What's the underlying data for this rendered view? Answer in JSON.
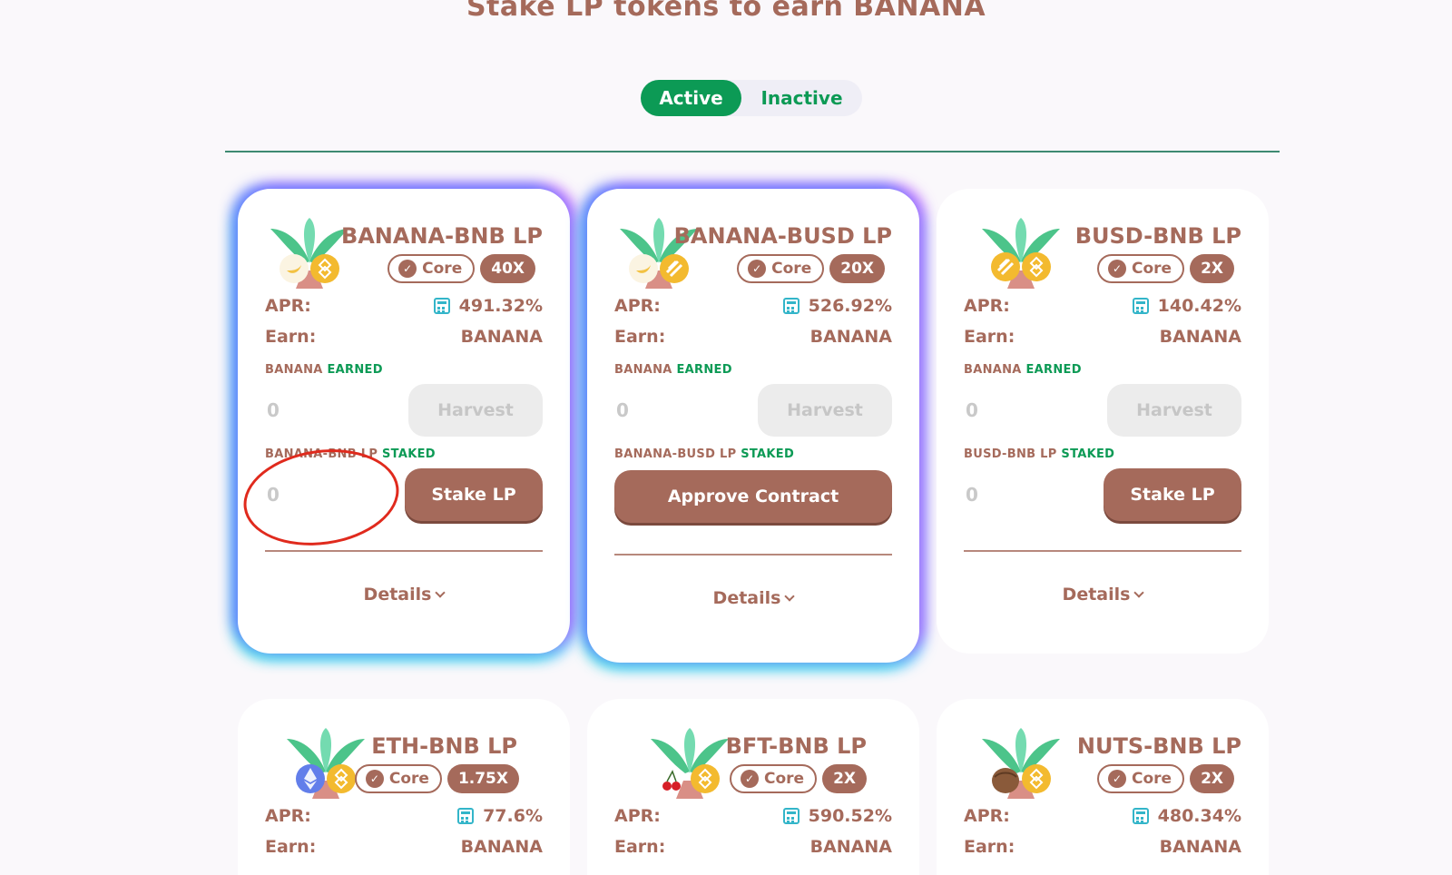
{
  "page": {
    "title": "Stake LP tokens to earn BANANA",
    "toggle": {
      "active": "Active",
      "inactive": "Inactive"
    }
  },
  "labels": {
    "apr": "APR:",
    "earn": "Earn:",
    "earned_prefix": "BANANA",
    "earned_suffix": "EARNED",
    "staked_suffix": "STAKED",
    "core": "Core",
    "harvest": "Harvest",
    "stake_lp": "Stake LP",
    "approve_contract": "Approve Contract",
    "details": "Details"
  },
  "farms": [
    {
      "name": "BANANA-BNB LP",
      "lp": "BANANA-BNB LP",
      "multiplier": "40X",
      "apr": "491.32%",
      "earn": "BANANA",
      "earned": "0",
      "staked": "0",
      "action": "stake"
    },
    {
      "name": "BANANA-BUSD LP",
      "lp": "BANANA-BUSD LP",
      "multiplier": "20X",
      "apr": "526.92%",
      "earn": "BANANA",
      "earned": "0",
      "staked": "",
      "action": "approve"
    },
    {
      "name": "BUSD-BNB LP",
      "lp": "BUSD-BNB LP",
      "multiplier": "2X",
      "apr": "140.42%",
      "earn": "BANANA",
      "earned": "0",
      "staked": "0",
      "action": "stake"
    },
    {
      "name": "ETH-BNB LP",
      "multiplier": "1.75X",
      "apr": "77.6%",
      "earn": "BANANA"
    },
    {
      "name": "BFT-BNB LP",
      "multiplier": "2X",
      "apr": "590.52%",
      "earn": "BANANA"
    },
    {
      "name": "NUTS-BNB LP",
      "multiplier": "2X",
      "apr": "480.34%",
      "earn": "BANANA"
    }
  ],
  "colors": {
    "primary": "#a56a5b",
    "green": "#0c9a55",
    "annotation": "#e02a1d"
  }
}
